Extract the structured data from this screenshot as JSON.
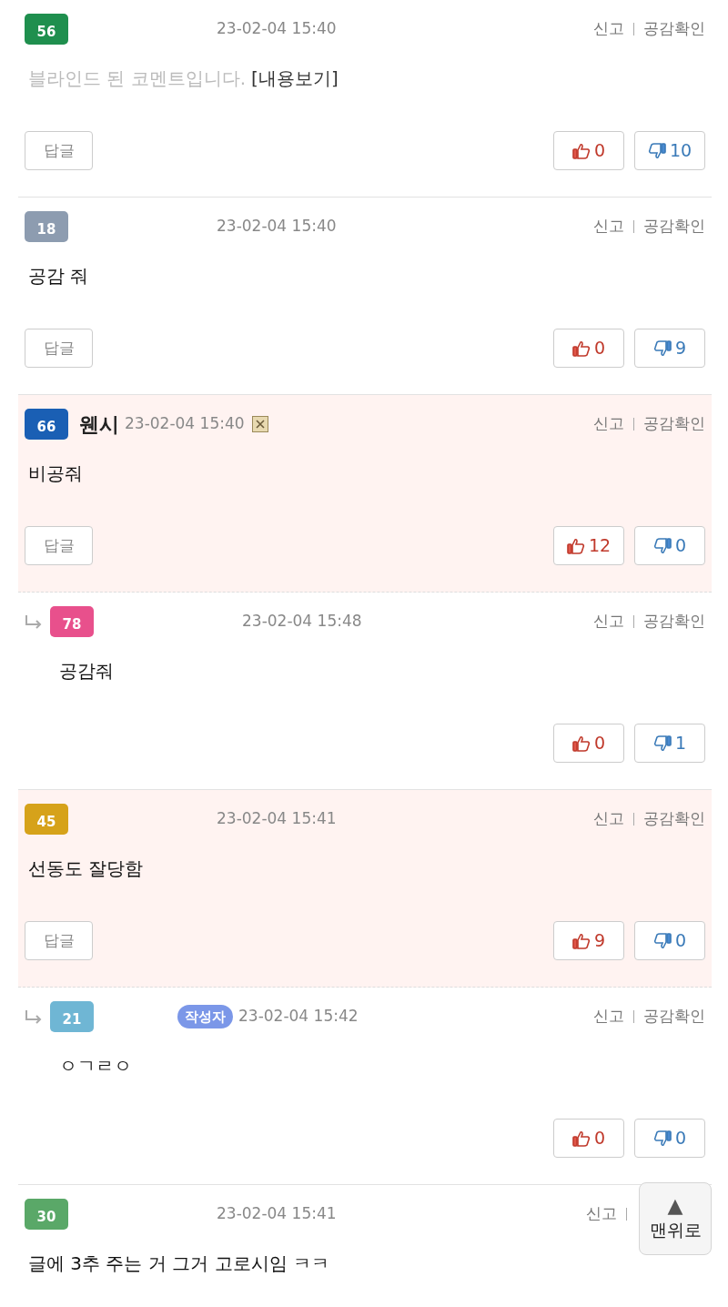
{
  "comments": [
    {
      "level": "56",
      "color": "#1f8f4e",
      "reply": false,
      "highlighted": false,
      "date": "23-02-04 15:40",
      "report": "신고",
      "empathy": "공감확인",
      "blind_notice": "블라인드 된 코멘트입니다.",
      "view_link": "[내용보기]",
      "reply_button": "답글",
      "up": "0",
      "down": "10"
    },
    {
      "level": "18",
      "color": "#8d9cb0",
      "reply": false,
      "highlighted": false,
      "date": "23-02-04 15:40",
      "report": "신고",
      "empathy": "공감확인",
      "text": "공감 줘",
      "reply_button": "답글",
      "up": "0",
      "down": "9"
    },
    {
      "level": "66",
      "color": "#1a5fb4",
      "reply": false,
      "highlighted": true,
      "nickname": "웬시",
      "date": "23-02-04 15:40",
      "report": "신고",
      "empathy": "공감확인",
      "text": "비공줘",
      "reply_button": "답글",
      "up": "12",
      "down": "0"
    },
    {
      "level": "78",
      "color": "#e8508c",
      "reply": true,
      "highlighted": false,
      "date": "23-02-04 15:48",
      "report": "신고",
      "empathy": "공감확인",
      "text": "공감줘",
      "up": "0",
      "down": "1"
    },
    {
      "level": "45",
      "color": "#d6a21a",
      "reply": false,
      "highlighted": true,
      "date": "23-02-04 15:41",
      "report": "신고",
      "empathy": "공감확인",
      "text": "선동도 잘당함",
      "reply_button": "답글",
      "up": "9",
      "down": "0"
    },
    {
      "level": "21",
      "color": "#6fb6d4",
      "reply": true,
      "highlighted": false,
      "author_badge": "작성자",
      "date": "23-02-04 15:42",
      "report": "신고",
      "empathy": "공감확인",
      "text": "ㅇㄱㄹㅇ",
      "up": "0",
      "down": "0"
    },
    {
      "level": "30",
      "color": "#5aa868",
      "reply": false,
      "highlighted": false,
      "date": "23-02-04 15:41",
      "report": "신고",
      "text": "글에 3추 주는 거 그거 고로시임 ㅋㅋ"
    }
  ],
  "top_button": {
    "arrow": "▲",
    "label": "맨위로"
  }
}
